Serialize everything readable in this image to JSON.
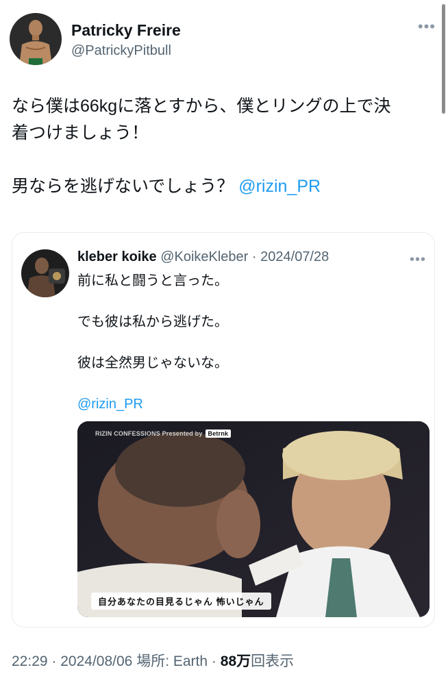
{
  "tweet": {
    "author": {
      "name": "Patricky Freire",
      "handle": "@PatrickyPitbull"
    },
    "text_lines": [
      "なら僕は66kgに落とすから、僕とリングの上で決",
      "着つけましょう！",
      "男ならを逃げないでしょう？"
    ],
    "mention": "@rizin_PR",
    "footer": {
      "time": "22:29",
      "separator": "·",
      "date": "2024/08/06",
      "location_label": "場所: Earth",
      "views_count": "88万",
      "views_label": "回表示"
    }
  },
  "quoted_tweet": {
    "author": {
      "name": "kleber koike",
      "handle": "@KoikeKleber",
      "date": "2024/07/28"
    },
    "lines": [
      "前に私と闘うと言った。",
      "でも彼は私から逃げた。",
      "彼は全然男じゃないな。"
    ],
    "mention": "@rizin_PR",
    "media": {
      "banner_text": "RIZIN CONFESSIONS Presented by",
      "banner_brand": "Betrnk",
      "subtitle": "自分あなたの目見るじゃん 怖いじゃん"
    }
  },
  "colors": {
    "link": "#1d9bf0",
    "secondary_text": "#536471",
    "primary_text": "#0f1419"
  },
  "icons": [
    "more-options-icon",
    "avatar-image",
    "video-thumbnail"
  ]
}
